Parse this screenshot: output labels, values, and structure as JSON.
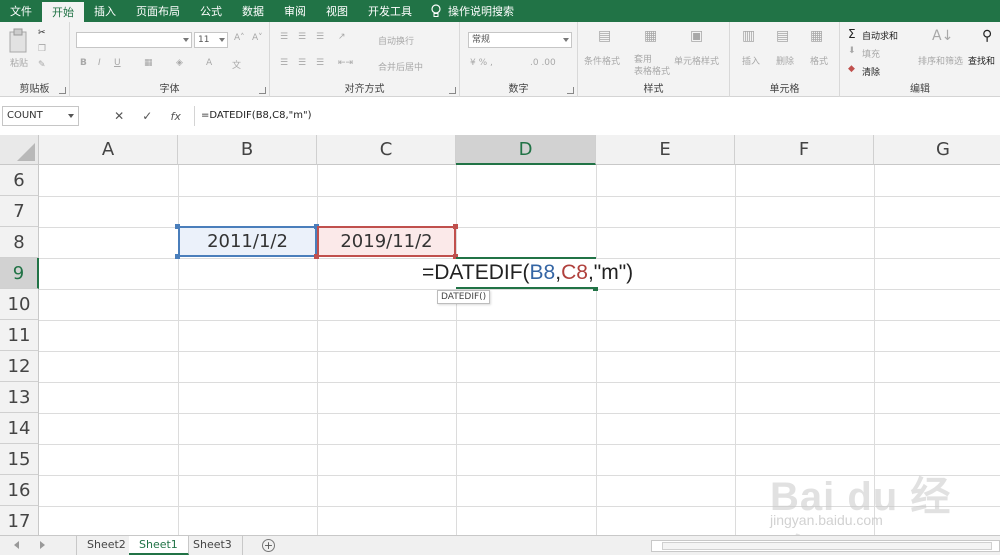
{
  "ribbon_tabs": [
    "文件",
    "开始",
    "插入",
    "页面布局",
    "公式",
    "数据",
    "审阅",
    "视图",
    "开发工具"
  ],
  "tell_me": "操作说明搜索",
  "ribbon": {
    "clipboard": {
      "paste": "粘贴",
      "label": "剪贴板"
    },
    "font": {
      "name": "",
      "size": "11",
      "bold": "B",
      "italic": "I",
      "underline": "U",
      "label": "字体"
    },
    "alignment": {
      "wrap": "自动换行",
      "merge": "合并后居中",
      "label": "对齐方式"
    },
    "number": {
      "format": "常规",
      "label": "数字"
    },
    "styles": {
      "conditional": "条件格式",
      "table": "套用\n表格格式",
      "cell_styles": "单元格样式",
      "label": "样式"
    },
    "cells": {
      "insert": "插入",
      "delete": "删除",
      "format": "格式",
      "label": "单元格"
    },
    "editing": {
      "autosum": "自动求和",
      "fill": "填充",
      "clear": "清除",
      "sort": "排序和筛选",
      "find": "查找和",
      "label": "编辑"
    }
  },
  "name_box": "COUNT",
  "formula_bar_icons": [
    "✕",
    "✓",
    "fx"
  ],
  "formula": "=DATEDIF(B8,C8,\"m\")",
  "columns": [
    "A",
    "B",
    "C",
    "D",
    "E",
    "F",
    "G"
  ],
  "rows": [
    "6",
    "7",
    "8",
    "9",
    "10",
    "11",
    "12",
    "13",
    "14",
    "15",
    "16",
    "17"
  ],
  "cells": {
    "B8": "2011/1/2",
    "C8": "2019/11/2"
  },
  "edit": {
    "prefix": "=DATEDIF(",
    "ref1": "B8",
    "comma1": ",",
    "ref2": "C8",
    "rest": ",\"m\")",
    "tooltip": "DATEDIF()"
  },
  "sheets": [
    "Sheet2",
    "Sheet1",
    "Sheet3"
  ],
  "active_sheet": "Sheet1",
  "add_sheet": "+",
  "watermark": {
    "text": "Bai du 经验",
    "sub": "jingyan.baidu.com"
  },
  "colors": {
    "excel_green": "#217346",
    "ref_blue": "#4a7ebb",
    "ref_red": "#c0504d"
  }
}
